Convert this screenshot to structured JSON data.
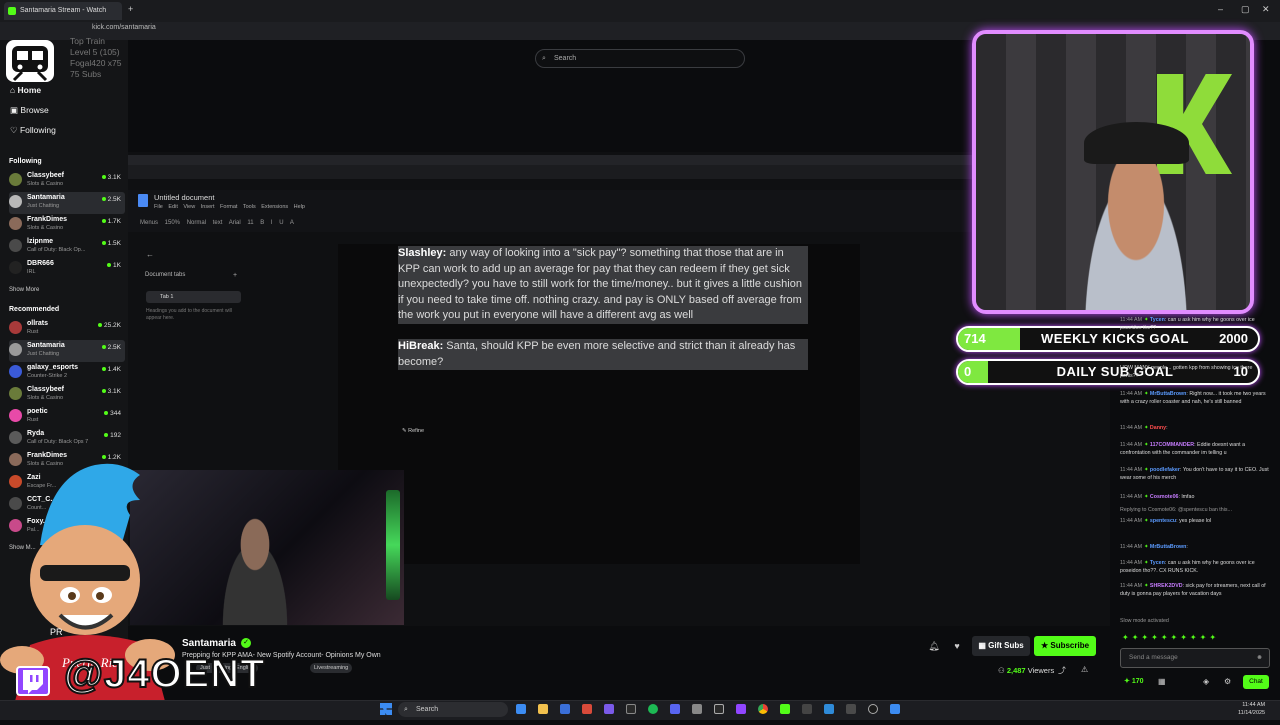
{
  "browser": {
    "tab_title": "Santamaria Stream - Watch",
    "url": "kick.com/santamaria"
  },
  "sidebar": {
    "nav": [
      "Home",
      "Browse",
      "Following"
    ],
    "following_header": "Following",
    "following": [
      {
        "name": "Classybeef",
        "category": "Slots & Casino",
        "viewers": "3.1K"
      },
      {
        "name": "Santamaria",
        "category": "Just Chatting",
        "viewers": "2.5K"
      },
      {
        "name": "FrankDimes",
        "category": "Slots & Casino",
        "viewers": "1.7K"
      },
      {
        "name": "lzipnme",
        "category": "Call of Duty: Black Op...",
        "viewers": "1.5K"
      },
      {
        "name": "DBR666",
        "category": "IRL",
        "viewers": "1K"
      }
    ],
    "show_more": "Show More",
    "recommended_header": "Recommended",
    "recommended": [
      {
        "name": "ollrats",
        "category": "Rust",
        "viewers": "25.2K"
      },
      {
        "name": "Santamaria",
        "category": "Just Chatting",
        "viewers": "2.5K"
      },
      {
        "name": "galaxy_esports",
        "category": "Counter-Strike 2",
        "viewers": "1.4K"
      },
      {
        "name": "Classybeef",
        "category": "Slots & Casino",
        "viewers": "3.1K"
      },
      {
        "name": "poetic",
        "category": "Rust",
        "viewers": "344"
      },
      {
        "name": "Ryda",
        "category": "Call of Duty: Black Ops 7",
        "viewers": "192"
      },
      {
        "name": "FrankDimes",
        "category": "Slots & Casino",
        "viewers": "1.2K"
      },
      {
        "name": "Zazi",
        "category": "Escape Fr...",
        "viewers": ""
      },
      {
        "name": "CCT_C...",
        "category": "Count...",
        "viewers": ""
      },
      {
        "name": "Foxy...",
        "category": "Pal...",
        "viewers": ""
      }
    ],
    "show_more_2": "Show M..."
  },
  "overlay_topleft": {
    "lines": [
      "Top Train",
      "Level 5 (105)",
      "Fogal420 x75",
      "75 Subs"
    ]
  },
  "search": {
    "placeholder": "Search"
  },
  "doc": {
    "title": "Untitled document",
    "menu": "File Edit View Insert Format Tools Extensions Help",
    "toolbar": "Menus 150% Normal text Arial 11 B I U A",
    "tabs_label": "Document tabs",
    "tab1": "Tab 1",
    "headings_note": "Headings you add to the document will appear here.",
    "p1_name": "Slashley:",
    "p1_text": " any way of looking into a \"sick pay\"? something that those that are in KPP can work to add up an average for pay that they can redeem if they get sick unexpectedly? you have to still work for the time/money.. but it gives a little cushion if you need to take time off. nothing crazy. and pay is ONLY based off average from the work you put in everyone will have a different avg as well",
    "p2_name": "HiBreak:",
    "p2_text": " Santa, should KPP be even more selective and strict than it already has become?",
    "refine": "Refine"
  },
  "stream": {
    "streamer": "Santamaria",
    "title": "Prepping for KPP AMA- New Spotify Account- Opinions My Own",
    "tags": [
      "Just Chatting",
      "English",
      "Livestreaming"
    ],
    "viewers": "2,487",
    "viewers_label": "Viewers",
    "gift_subs": "Gift Subs",
    "subscribe": "Subscribe"
  },
  "overlay": {
    "handle": "@J4OENT"
  },
  "goals": [
    {
      "current": "714",
      "label": "WEEKLY KICKS GOAL",
      "target": "2000",
      "progress": 0.36
    },
    {
      "current": "0",
      "label": "DAILY SUB GOAL",
      "target": "10",
      "progress": 0.0
    }
  ],
  "chat": {
    "messages": [
      {
        "time": "11:44 AM",
        "user": "Tycen",
        "color": "#5b9bff",
        "text": "can u ask him why he goons over ice poseidon the??"
      },
      {
        "time": "",
        "user": "",
        "color": "#ddd",
        "text": "HOW MANY people... gotten kpp from showing ice there penis??"
      },
      {
        "time": "11:44 AM",
        "user": "MrButtaBrown",
        "color": "#5b9bff",
        "text": "Right now... it took me two years with a crazy roller coaster and nah, he's still banned"
      },
      {
        "time": "11:44 AM",
        "user": "Danny",
        "color": "#ff4d4d",
        "text": ""
      },
      {
        "time": "11:44 AM",
        "user": "117COMMANDER",
        "color": "#c77dff",
        "text": "Eddie doesnt want a confrontation with the commander im telling u"
      },
      {
        "time": "11:44 AM",
        "user": "poodlefaker",
        "color": "#5b9bff",
        "text": "You don't have to say it to CEO. Just wear some of his merch"
      },
      {
        "time": "11:44 AM",
        "user": "Cosmote06",
        "color": "#c77dff",
        "text": "lmfao"
      },
      {
        "time": "",
        "user": "",
        "color": "#999",
        "text": "Replying to Cosmote06: @spentescu ban this..."
      },
      {
        "time": "11:44 AM",
        "user": "spentescu",
        "color": "#5b9bff",
        "text": "yes please lol"
      },
      {
        "time": "11:44 AM",
        "user": "MrButtaBrown",
        "color": "#5b9bff",
        "text": ""
      },
      {
        "time": "11:44 AM",
        "user": "Tycen",
        "color": "#5b9bff",
        "text": "can u ask him why he goons over ice poseidon tho??. CX RUNS KICK."
      },
      {
        "time": "11:44 AM",
        "user": "SHREK2DVD",
        "color": "#c77dff",
        "text": "sick pay for streamers, next call of duty is gonna pay players for vacation days"
      },
      {
        "time": "",
        "user": "",
        "color": "#999",
        "text": "Slow mode activated"
      }
    ],
    "input_placeholder": "Send a message",
    "kicks": "170",
    "chat_button": "Chat"
  },
  "taskbar": {
    "search": "Search",
    "time": "11:44 AM",
    "date": "11/14/2025"
  },
  "colors": {
    "kick_green": "#53fc18",
    "neon_purple": "#c04dff",
    "twitch_purple": "#9146ff"
  }
}
